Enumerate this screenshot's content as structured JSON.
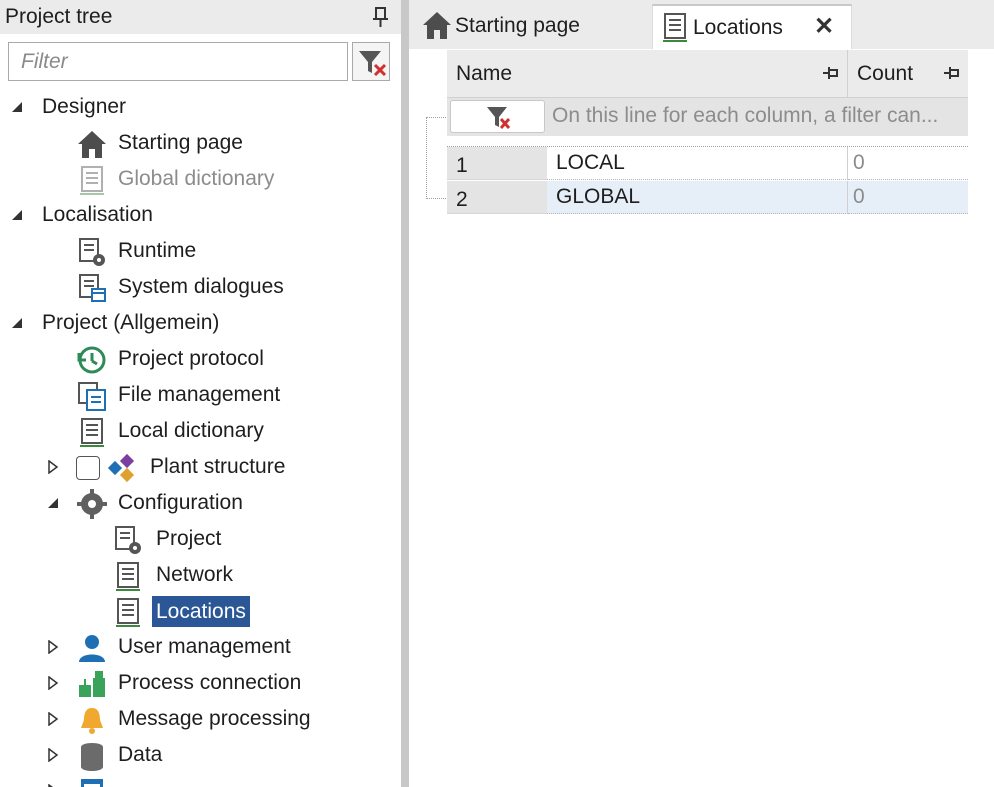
{
  "left_panel": {
    "title": "Project tree",
    "filter_placeholder": "Filter",
    "tree": [
      {
        "id": "designer",
        "label": "Designer",
        "level": 0,
        "expander": "expanded",
        "icon": "none"
      },
      {
        "id": "starting-page",
        "label": "Starting page",
        "level": 1,
        "expander": "none",
        "icon": "home-icon"
      },
      {
        "id": "global-dictionary",
        "label": "Global dictionary",
        "level": 1,
        "expander": "none",
        "icon": "dictionary-icon",
        "disabled": true
      },
      {
        "id": "localisation",
        "label": "Localisation",
        "level": 0,
        "expander": "expanded",
        "icon": "none"
      },
      {
        "id": "runtime",
        "label": "Runtime",
        "level": 1,
        "expander": "none",
        "icon": "runtime-icon"
      },
      {
        "id": "system-dialogues",
        "label": "System dialogues",
        "level": 1,
        "expander": "none",
        "icon": "dialog-icon"
      },
      {
        "id": "project-allgemein",
        "label": "Project (Allgemein)",
        "level": 0,
        "expander": "expanded",
        "icon": "none"
      },
      {
        "id": "project-protocol",
        "label": "Project protocol",
        "level": 1,
        "expander": "none",
        "icon": "history-icon"
      },
      {
        "id": "file-management",
        "label": "File management",
        "level": 1,
        "expander": "none",
        "icon": "files-icon"
      },
      {
        "id": "local-dictionary",
        "label": "Local dictionary",
        "level": 1,
        "expander": "none",
        "icon": "dictionary-icon"
      },
      {
        "id": "plant-structure",
        "label": "Plant structure",
        "level": 1,
        "expander": "collapsed",
        "icon": "plant-icon",
        "checkbox": true
      },
      {
        "id": "configuration",
        "label": "Configuration",
        "level": 1,
        "expander": "expanded",
        "icon": "gear-icon"
      },
      {
        "id": "config-project",
        "label": "Project",
        "level": 2,
        "expander": "none",
        "icon": "runtime-icon"
      },
      {
        "id": "network",
        "label": "Network",
        "level": 2,
        "expander": "none",
        "icon": "dictionary-icon"
      },
      {
        "id": "locations",
        "label": "Locations",
        "level": 2,
        "expander": "none",
        "icon": "dictionary-icon",
        "selected": true
      },
      {
        "id": "user-management",
        "label": "User management",
        "level": 1,
        "expander": "collapsed",
        "icon": "user-icon"
      },
      {
        "id": "process-connection",
        "label": "Process connection",
        "level": 1,
        "expander": "collapsed",
        "icon": "process-icon"
      },
      {
        "id": "message-processing",
        "label": "Message processing",
        "level": 1,
        "expander": "collapsed",
        "icon": "bell-icon"
      },
      {
        "id": "data",
        "label": "Data",
        "level": 1,
        "expander": "collapsed",
        "icon": "database-icon"
      },
      {
        "id": "reports",
        "label": "",
        "level": 1,
        "expander": "collapsed",
        "icon": "report-icon"
      }
    ]
  },
  "tabs": [
    {
      "id": "starting",
      "label": "Starting page",
      "icon": "home-icon",
      "active": false
    },
    {
      "id": "locations",
      "label": "Locations",
      "icon": "dictionary-icon",
      "active": true
    }
  ],
  "grid": {
    "columns": [
      {
        "id": "name",
        "label": "Name"
      },
      {
        "id": "count",
        "label": "Count"
      }
    ],
    "filter_hint": "On this line for each column, a filter can...",
    "rows": [
      {
        "num": "1",
        "name": "LOCAL",
        "count": "0"
      },
      {
        "num": "2",
        "name": "GLOBAL",
        "count": "0"
      }
    ]
  },
  "colors": {
    "selection": "#2b5797",
    "header_bg": "#ebebeb",
    "alt_row": "#e6eef8",
    "green_accent": "#3a8a3a"
  }
}
